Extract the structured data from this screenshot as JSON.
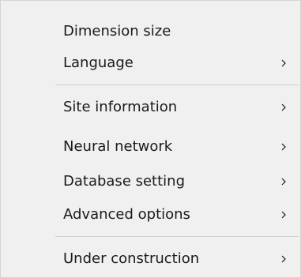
{
  "menu": {
    "items": [
      {
        "label": "Dimension size",
        "has_submenu": false
      },
      {
        "label": "Language",
        "has_submenu": true,
        "submenu_icon": "chevron-right-icon"
      },
      {
        "label": "Site information",
        "has_submenu": true,
        "submenu_icon": "chevron-right-icon"
      },
      {
        "label": "Neural network",
        "has_submenu": true,
        "submenu_icon": "chevron-right-icon"
      },
      {
        "label": "Database setting",
        "has_submenu": true,
        "submenu_icon": "chevron-right-icon"
      },
      {
        "label": "Advanced options",
        "has_submenu": true,
        "submenu_icon": "chevron-right-icon"
      },
      {
        "label": "Under construction",
        "has_submenu": true,
        "submenu_icon": "chevron-right-icon"
      }
    ]
  },
  "colors": {
    "menu_background": "#f0f0f0",
    "text": "#1a1a1a",
    "separator": "#cfcfcf",
    "border": "#d4d4d4"
  }
}
